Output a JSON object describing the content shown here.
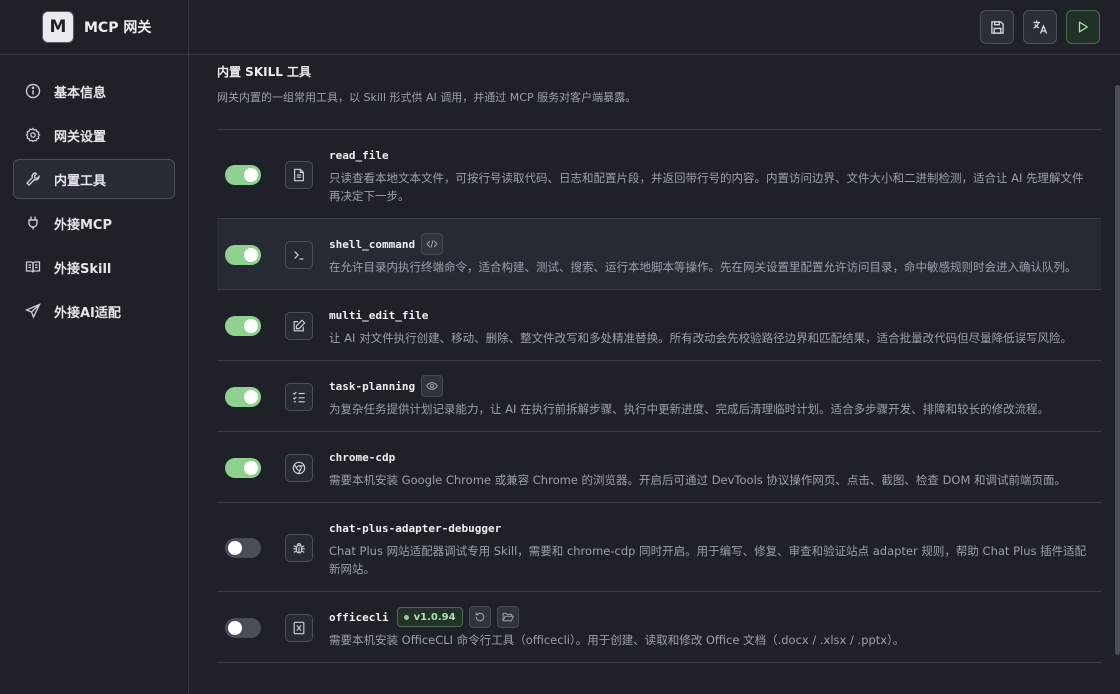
{
  "app": {
    "logo": "M",
    "title": "MCP 网关"
  },
  "sidebar": {
    "items": [
      {
        "label": "基本信息",
        "icon": "info-icon"
      },
      {
        "label": "网关设置",
        "icon": "gear-icon"
      },
      {
        "label": "内置工具",
        "icon": "wrench-icon",
        "active": true
      },
      {
        "label": "外接MCP",
        "icon": "plug-icon"
      },
      {
        "label": "外接Skill",
        "icon": "book-icon"
      },
      {
        "label": "外接AI适配",
        "icon": "send-icon"
      }
    ]
  },
  "toolbar": {
    "icons": [
      "save-icon",
      "translate-icon",
      "play-icon"
    ]
  },
  "section": {
    "title": "内置 SKILL 工具",
    "desc": "网关内置的一组常用工具，以 Skill 形式供 AI 调用，并通过 MCP 服务对客户端暴露。"
  },
  "tools": [
    {
      "name": "read_file",
      "enabled": true,
      "icon": "file-text-icon",
      "desc": "只读查看本地文本文件，可按行号读取代码、日志和配置片段，并返回带行号的内容。内置访问边界、文件大小和二进制检测，适合让 AI 先理解文件再决定下一步。"
    },
    {
      "name": "shell_command",
      "enabled": true,
      "icon": "terminal-icon",
      "badge_icon": "code-icon",
      "desc": "在允许目录内执行终端命令，适合构建、测试、搜索、运行本地脚本等操作。先在网关设置里配置允许访问目录，命中敏感规则时会进入确认队列。"
    },
    {
      "name": "multi_edit_file",
      "enabled": true,
      "icon": "edit-icon",
      "desc": "让 AI 对文件执行创建、移动、删除、整文件改写和多处精准替换。所有改动会先校验路径边界和匹配结果，适合批量改代码但尽量降低误写风险。"
    },
    {
      "name": "task-planning",
      "enabled": true,
      "icon": "checklist-icon",
      "badge_icon": "eye-icon",
      "desc": "为复杂任务提供计划记录能力，让 AI 在执行前拆解步骤、执行中更新进度、完成后清理临时计划。适合多步骤开发、排障和较长的修改流程。"
    },
    {
      "name": "chrome-cdp",
      "enabled": true,
      "icon": "chrome-icon",
      "desc": "需要本机安装 Google Chrome 或兼容 Chrome 的浏览器。开启后可通过 DevTools 协议操作网页、点击、截图、检查 DOM 和调试前端页面。"
    },
    {
      "name": "chat-plus-adapter-debugger",
      "enabled": false,
      "icon": "bug-icon",
      "desc": "Chat Plus 网站适配器调试专用 Skill，需要和 chrome-cdp 同时开启。用于编写、修复、审查和验证站点 adapter 规则，帮助 Chat Plus 插件适配新网站。"
    },
    {
      "name": "officecli",
      "enabled": false,
      "icon": "office-icon",
      "version": "v1.0.94",
      "desc": "需要本机安装 OfficeCLI 命令行工具（officecli）。用于创建、读取和修改 Office 文档（.docx / .xlsx / .pptx）。"
    }
  ]
}
